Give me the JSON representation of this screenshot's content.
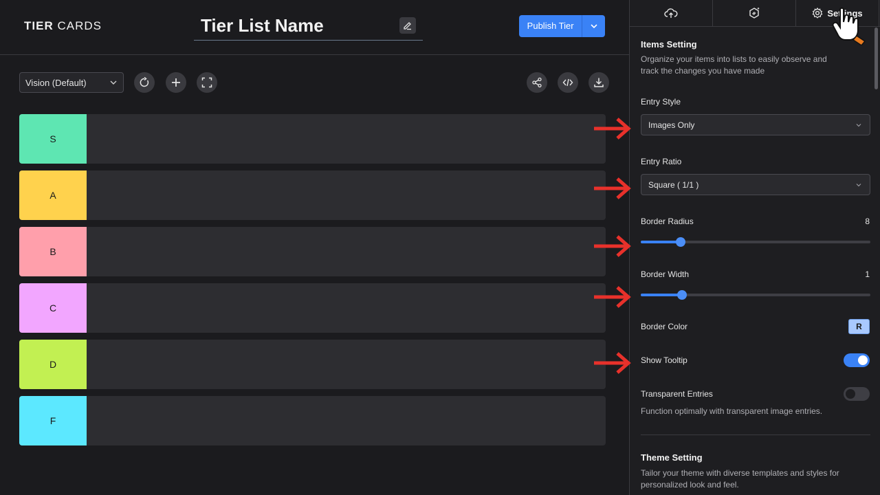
{
  "brand": {
    "bold": "TIER",
    "light": " CARDS"
  },
  "header": {
    "title": "Tier List Name",
    "publish_label": "Publish Tier"
  },
  "toolbar": {
    "template_select": "Vision (Default)"
  },
  "tiers": [
    {
      "label": "S",
      "color": "#5ee6b2"
    },
    {
      "label": "A",
      "color": "#ffd24d"
    },
    {
      "label": "B",
      "color": "#ff9fab"
    },
    {
      "label": "C",
      "color": "#f2a6ff"
    },
    {
      "label": "D",
      "color": "#c2f052"
    },
    {
      "label": "F",
      "color": "#5ce8ff"
    }
  ],
  "panel": {
    "tabs": [
      {
        "icon": "cloud-upload-icon",
        "label": ""
      },
      {
        "icon": "magic-cube-icon",
        "label": ""
      },
      {
        "icon": "gear-icon",
        "label": "Settings"
      }
    ],
    "items_heading": "Items Setting",
    "items_desc": "Organize your items into lists to easily observe and track the changes you have made",
    "entry_style_label": "Entry Style",
    "entry_style_value": "Images Only",
    "entry_ratio_label": "Entry Ratio",
    "entry_ratio_value": "Square ( 1/1 )",
    "border_radius_label": "Border Radius",
    "border_radius_value": "8",
    "border_width_label": "Border Width",
    "border_width_value": "1",
    "border_color_label": "Border Color",
    "border_color_value": "R",
    "show_tooltip_label": "Show Tooltip",
    "show_tooltip_on": true,
    "transparent_label": "Transparent Entries",
    "transparent_on": false,
    "transparent_desc": "Function optimally with transparent image entries.",
    "theme_heading": "Theme Setting",
    "theme_desc": "Tailor your theme with diverse templates and styles for personalized look and feel."
  },
  "colors": {
    "accent": "#3a82f6",
    "annotation_arrow": "#e8312b"
  }
}
